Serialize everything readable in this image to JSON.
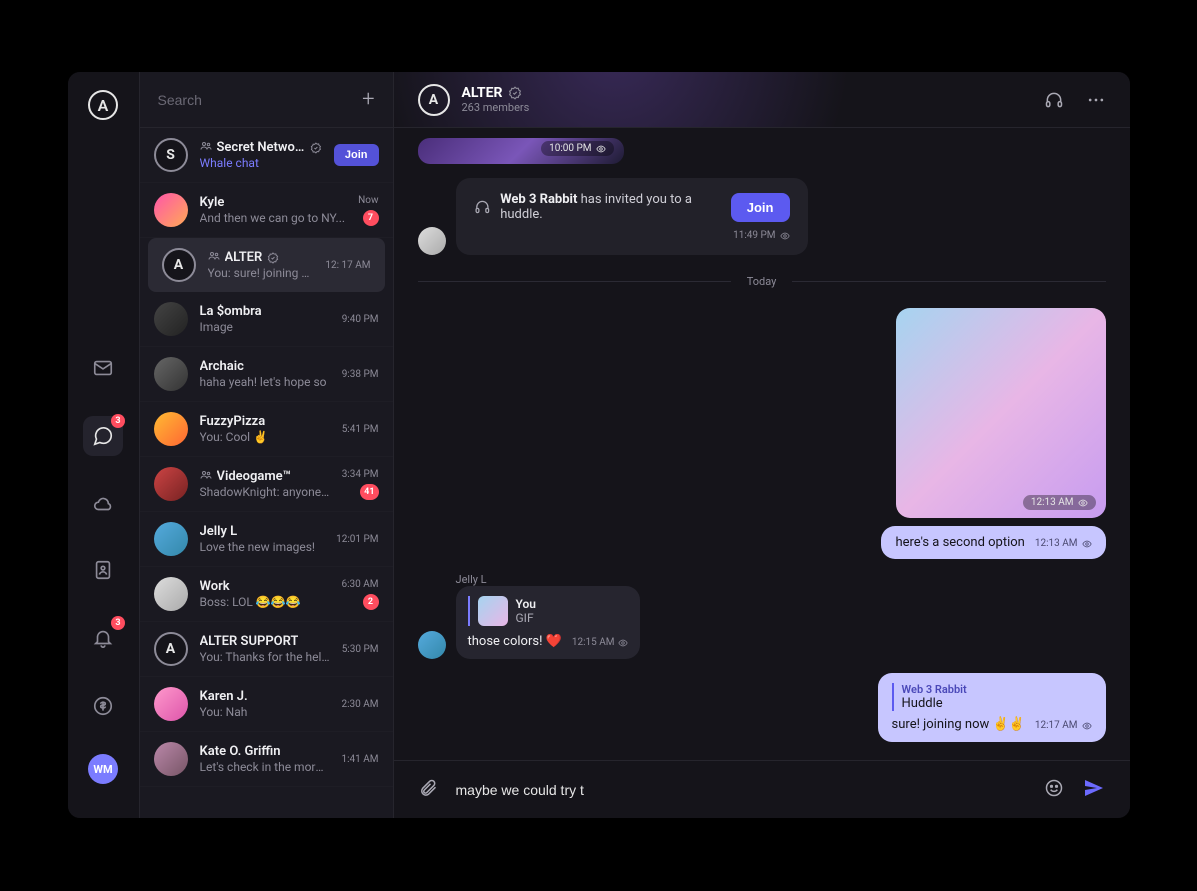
{
  "rail": {
    "logo_letter": "A",
    "chat_badge": "3",
    "bell_badge": "3",
    "user_initials": "WM"
  },
  "sidebar": {
    "search_placeholder": "Search",
    "chats": [
      {
        "name": "Secret Network",
        "snippet": "Whale chat",
        "time": "",
        "group": true,
        "verified": true,
        "accent": true,
        "join": true,
        "badge": "",
        "avatar_letter": "S",
        "avatar_ring": true
      },
      {
        "name": "Kyle",
        "snippet": "And then we can go to NY...",
        "time": "Now",
        "group": false,
        "verified": false,
        "accent": false,
        "join": false,
        "badge": "7",
        "avatar_class": "av-fill-1"
      },
      {
        "name": "ALTER",
        "snippet": "You: sure! joining now ✌✌",
        "time": "12: 17 AM",
        "group": true,
        "verified": true,
        "accent": false,
        "join": false,
        "badge": "",
        "avatar_letter": "A",
        "avatar_ring": true,
        "active": true
      },
      {
        "name": "La $ombra",
        "snippet": "Image",
        "time": "9:40 PM",
        "group": false,
        "verified": false,
        "accent": false,
        "join": false,
        "badge": "",
        "avatar_class": "av-fill-2"
      },
      {
        "name": "Archaic",
        "snippet": "haha yeah! let's hope so",
        "time": "9:38 PM",
        "group": false,
        "verified": false,
        "accent": false,
        "join": false,
        "badge": "",
        "avatar_class": "av-fill-3"
      },
      {
        "name": "FuzzyPizza",
        "snippet": "You: Cool ✌",
        "time": "5:41 PM",
        "group": false,
        "verified": false,
        "accent": false,
        "join": false,
        "badge": "",
        "avatar_class": "av-fill-4"
      },
      {
        "name": "Videogame™",
        "snippet": "ShadowKnight: anyone wanna...",
        "time": "3:34 PM",
        "group": true,
        "verified": false,
        "accent": false,
        "join": false,
        "badge": "41",
        "avatar_class": "av-fill-5"
      },
      {
        "name": "Jelly L",
        "snippet": "Love the new images!",
        "time": "12:01 PM",
        "group": false,
        "verified": false,
        "accent": false,
        "join": false,
        "badge": "",
        "avatar_class": "av-fill-6"
      },
      {
        "name": "Work",
        "snippet": "Boss: LOL 😂😂😂",
        "time": "6:30 AM",
        "group": false,
        "verified": false,
        "accent": false,
        "join": false,
        "badge": "2",
        "avatar_class": "av-fill-7"
      },
      {
        "name": "ALTER SUPPORT",
        "snippet": "You: Thanks for the help!",
        "time": "5:30 PM",
        "group": false,
        "verified": false,
        "accent": false,
        "join": false,
        "badge": "",
        "avatar_letter": "A",
        "avatar_ring": true
      },
      {
        "name": "Karen J.",
        "snippet": "You: Nah",
        "time": "2:30 AM",
        "group": false,
        "verified": false,
        "accent": false,
        "join": false,
        "badge": "",
        "avatar_class": "av-fill-8"
      },
      {
        "name": "Kate O. Griffin",
        "snippet": "Let's check in the morning",
        "time": "1:41 AM",
        "group": false,
        "verified": false,
        "accent": false,
        "join": false,
        "badge": "",
        "avatar_class": "av-fill-9"
      }
    ],
    "join_label": "Join"
  },
  "header": {
    "avatar_letter": "A",
    "title": "ALTER",
    "subtitle": "263 members"
  },
  "chat": {
    "img1_time": "10:00 PM",
    "huddle": {
      "actor": "Web 3 Rabbit",
      "text_rest": " has invited you to a huddle.",
      "join_label": "Join",
      "time": "11:49 PM"
    },
    "divider_label": "Today",
    "out_img_time": "12:13 AM",
    "out_text": "here's a second option",
    "out_text_time": "12:13 AM",
    "in": {
      "sender": "Jelly L",
      "reply_name": "You",
      "reply_type": "GIF",
      "text": "those colors!  ❤️",
      "time": "12:15 AM"
    },
    "out2": {
      "quote_name": "Web 3 Rabbit",
      "quote_text": "Huddle",
      "text": "sure! joining now ✌️✌️",
      "time": "12:17 AM"
    }
  },
  "composer": {
    "value": "maybe we could try t"
  }
}
